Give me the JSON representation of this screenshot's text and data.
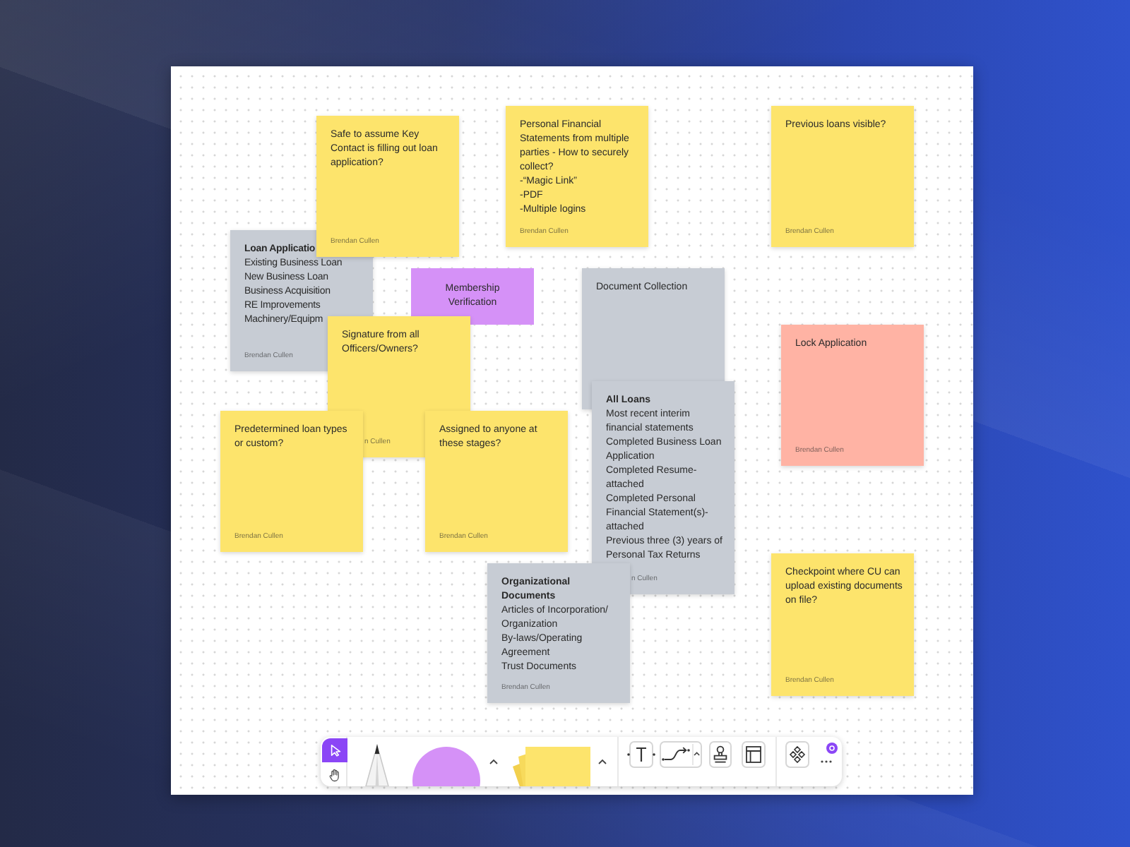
{
  "board": {
    "notes": [
      {
        "kind": "sticky",
        "color": "#fde46c",
        "lines": [
          "Safe to assume Key Contact is filling out loan application?"
        ],
        "author": "Brendan Cullen"
      },
      {
        "kind": "sticky",
        "color": "#fde46c",
        "lines": [
          "Personal Financial Statements from multiple parties - How to securely collect?",
          "-“Magic Link”",
          "-PDF",
          "-Multiple logins"
        ],
        "author": "Brendan Cullen"
      },
      {
        "kind": "sticky",
        "color": "#fde46c",
        "lines": [
          "Previous loans visible?"
        ],
        "author": "Brendan Cullen"
      },
      {
        "kind": "sticky",
        "color": "#c7ccd4",
        "heading": "Loan Applicatio",
        "lines": [
          "Existing Business Loan",
          "New Business Loan",
          "Business Acquisition",
          "RE Improvements",
          "Machinery/Equipm"
        ],
        "author": "Brendan Cullen"
      },
      {
        "kind": "shape",
        "color": "#d591f7",
        "lines": [
          "Membership Verification"
        ]
      },
      {
        "kind": "sticky",
        "color": "#c7ccd4",
        "lines": [
          "Document Collection"
        ]
      },
      {
        "kind": "sticky",
        "color": "#fde46c",
        "lines": [
          "Signature from all Officers/Owners?"
        ],
        "author": "n Cullen"
      },
      {
        "kind": "sticky",
        "color": "#ffb3a4",
        "lines": [
          "Lock Application"
        ],
        "author": "Brendan Cullen"
      },
      {
        "kind": "sticky",
        "color": "#c7ccd4",
        "heading": "All Loans",
        "lines": [
          "Most recent interim financial statements",
          "Completed Business Loan Application",
          "Completed Resume-attached",
          "Completed Personal Financial Statement(s)-attached",
          "Previous three (3) years of Personal Tax Returns"
        ],
        "author": "n Cullen"
      },
      {
        "kind": "sticky",
        "color": "#fde46c",
        "lines": [
          "Predetermined loan types or custom?"
        ],
        "author": "Brendan Cullen"
      },
      {
        "kind": "sticky",
        "color": "#fde46c",
        "lines": [
          "Assigned to anyone at these stages?"
        ],
        "author": "Brendan Cullen"
      },
      {
        "kind": "sticky",
        "color": "#fde46c",
        "lines": [
          "Checkpoint where CU can upload existing documents on file?"
        ],
        "author": "Brendan Cullen"
      },
      {
        "kind": "sticky",
        "color": "#c7ccd4",
        "heading": "Organizational Documents",
        "lines": [
          "Articles of Incorporation/Organization",
          "By-laws/Operating Agreement",
          "Trust Documents"
        ],
        "author": "Brendan Cullen"
      }
    ]
  },
  "toolbar": {
    "tools": [
      {
        "kind": "select",
        "selected": true
      },
      {
        "kind": "hand",
        "selected": false
      }
    ]
  }
}
